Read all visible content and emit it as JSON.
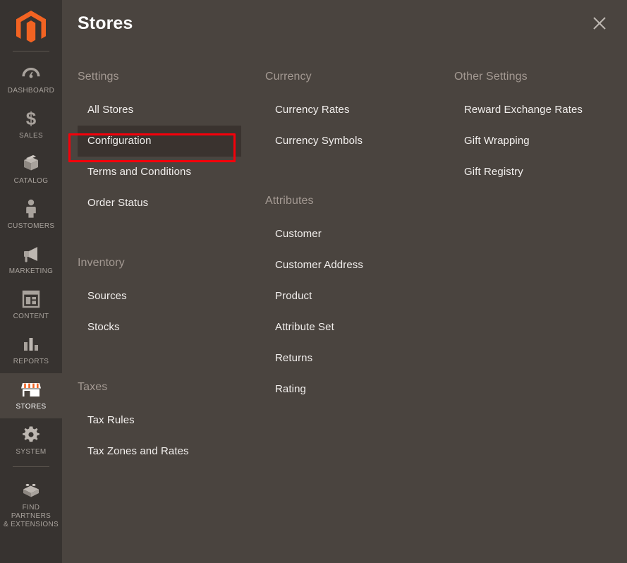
{
  "sidebar": {
    "logo": {
      "icon": "magento-logo-icon",
      "color": "#f26322"
    },
    "items": [
      {
        "id": "dashboard",
        "label": "DASHBOARD",
        "icon": "gauge-icon",
        "active": false
      },
      {
        "id": "sales",
        "label": "SALES",
        "icon": "dollar-icon",
        "active": false
      },
      {
        "id": "catalog",
        "label": "CATALOG",
        "icon": "box-icon",
        "active": false
      },
      {
        "id": "customers",
        "label": "CUSTOMERS",
        "icon": "person-icon",
        "active": false
      },
      {
        "id": "marketing",
        "label": "MARKETING",
        "icon": "megaphone-icon",
        "active": false
      },
      {
        "id": "content",
        "label": "CONTENT",
        "icon": "layout-icon",
        "active": false
      },
      {
        "id": "reports",
        "label": "REPORTS",
        "icon": "bar-chart-icon",
        "active": false
      },
      {
        "id": "stores",
        "label": "STORES",
        "icon": "storefront-icon",
        "active": true
      },
      {
        "id": "system",
        "label": "SYSTEM",
        "icon": "gear-icon",
        "active": false
      },
      {
        "id": "find-partners",
        "label": "FIND PARTNERS\n& EXTENSIONS",
        "label_line1": "FIND PARTNERS",
        "label_line2": "& EXTENSIONS",
        "icon": "lego-block-icon",
        "active": false
      }
    ]
  },
  "panel": {
    "title": "Stores",
    "close_icon": "close-icon",
    "columns": [
      {
        "id": "column-1",
        "groups": [
          {
            "id": "settings",
            "title": "Settings",
            "items": [
              {
                "id": "all-stores",
                "label": "All Stores",
                "highlighted": false
              },
              {
                "id": "configuration",
                "label": "Configuration",
                "highlighted": true
              },
              {
                "id": "terms-and-conditions",
                "label": "Terms and Conditions",
                "highlighted": false
              },
              {
                "id": "order-status",
                "label": "Order Status",
                "highlighted": false
              }
            ]
          },
          {
            "id": "inventory",
            "title": "Inventory",
            "items": [
              {
                "id": "sources",
                "label": "Sources",
                "highlighted": false
              },
              {
                "id": "stocks",
                "label": "Stocks",
                "highlighted": false
              }
            ]
          },
          {
            "id": "taxes",
            "title": "Taxes",
            "items": [
              {
                "id": "tax-rules",
                "label": "Tax Rules",
                "highlighted": false
              },
              {
                "id": "tax-zones-and-rates",
                "label": "Tax Zones and Rates",
                "highlighted": false
              }
            ]
          }
        ]
      },
      {
        "id": "column-2",
        "groups": [
          {
            "id": "currency",
            "title": "Currency",
            "items": [
              {
                "id": "currency-rates",
                "label": "Currency Rates",
                "highlighted": false
              },
              {
                "id": "currency-symbols",
                "label": "Currency Symbols",
                "highlighted": false
              }
            ]
          },
          {
            "id": "attributes",
            "title": "Attributes",
            "items": [
              {
                "id": "customer",
                "label": "Customer",
                "highlighted": false
              },
              {
                "id": "customer-address",
                "label": "Customer Address",
                "highlighted": false
              },
              {
                "id": "product",
                "label": "Product",
                "highlighted": false
              },
              {
                "id": "attribute-set",
                "label": "Attribute Set",
                "highlighted": false
              },
              {
                "id": "returns",
                "label": "Returns",
                "highlighted": false
              },
              {
                "id": "rating",
                "label": "Rating",
                "highlighted": false
              }
            ]
          }
        ]
      },
      {
        "id": "column-3",
        "groups": [
          {
            "id": "other-settings",
            "title": "Other Settings",
            "items": [
              {
                "id": "reward-exchange-rates",
                "label": "Reward Exchange Rates",
                "highlighted": false
              },
              {
                "id": "gift-wrapping",
                "label": "Gift Wrapping",
                "highlighted": false
              },
              {
                "id": "gift-registry",
                "label": "Gift Registry",
                "highlighted": false
              }
            ]
          }
        ]
      }
    ]
  },
  "annotation": {
    "id": "configuration-highlight",
    "color": "#f5000a",
    "target": "Configuration"
  },
  "colors": {
    "sidebar_bg": "#373330",
    "panel_bg": "#4a443f",
    "accent_orange": "#f26322",
    "heading_grey": "#a39992",
    "link_white": "#f2efed",
    "highlight_red": "#f5000a"
  }
}
